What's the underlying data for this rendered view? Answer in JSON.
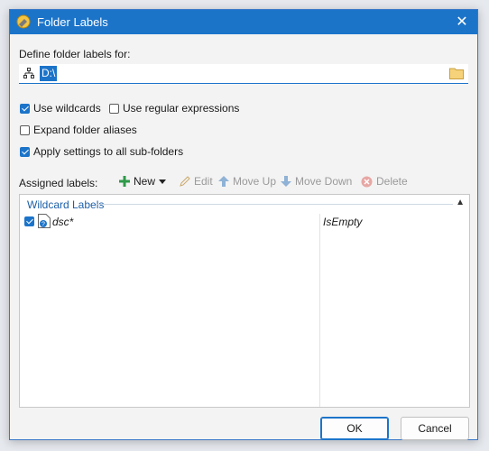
{
  "window": {
    "title": "Folder Labels",
    "close_glyph": "✕"
  },
  "define": {
    "label": "Define folder labels for:",
    "path_value": "D:\\"
  },
  "options": {
    "use_wildcards": {
      "label": "Use wildcards",
      "checked": true
    },
    "use_regex": {
      "label": "Use regular expressions",
      "checked": false
    },
    "expand_aliases": {
      "label": "Expand folder aliases",
      "checked": false
    },
    "apply_subfolders": {
      "label": "Apply settings to all sub-folders",
      "checked": true
    }
  },
  "toolbar": {
    "assigned_label": "Assigned labels:",
    "new_label": "New",
    "edit_label": "Edit",
    "move_up_label": "Move Up",
    "move_down_label": "Move Down",
    "delete_label": "Delete"
  },
  "list": {
    "group_header": "Wildcard Labels",
    "rows": [
      {
        "name": "dsc*",
        "label": "IsEmpty",
        "checked": true
      }
    ]
  },
  "buttons": {
    "ok_label": "OK",
    "cancel_label": "Cancel"
  },
  "colors": {
    "accent": "#1c74c9",
    "new_green": "#2e9a48",
    "delete_red": "#d9534f"
  }
}
